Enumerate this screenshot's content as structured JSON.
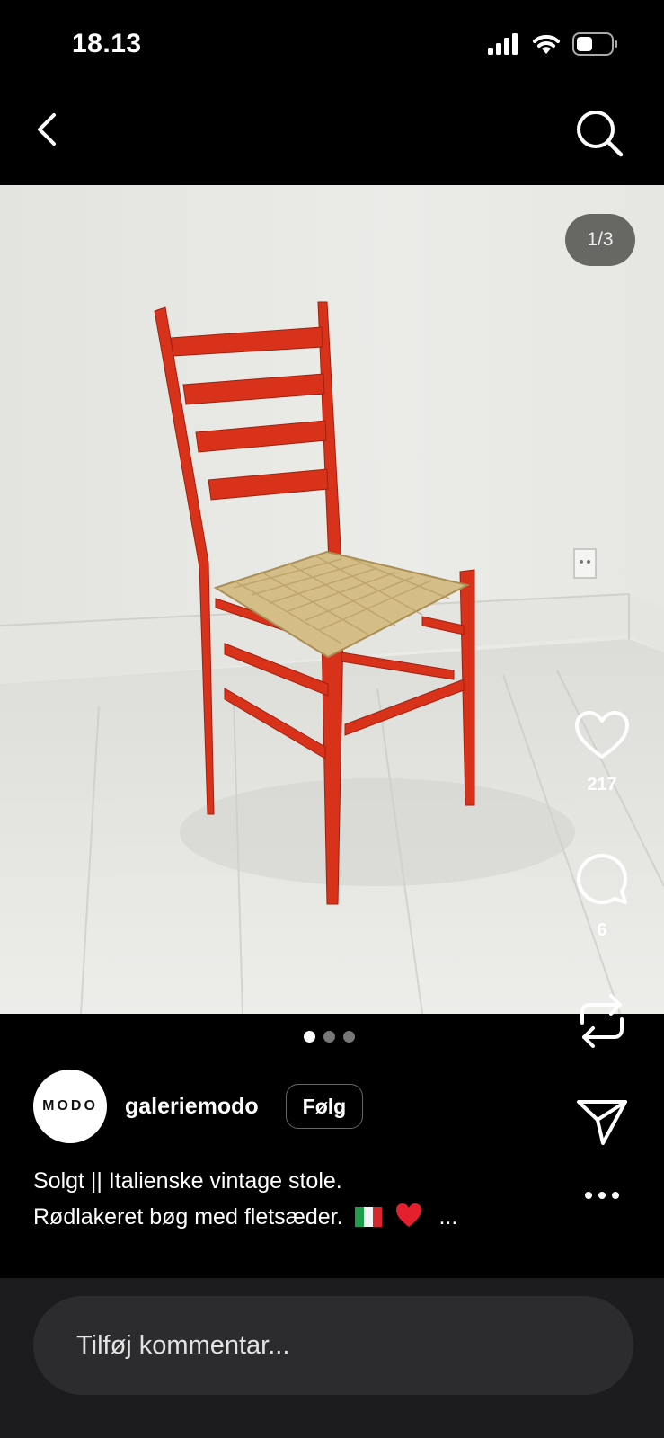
{
  "status_bar": {
    "time": "18.13",
    "icons": [
      "signal-icon",
      "wifi-icon",
      "battery-icon"
    ]
  },
  "nav": {
    "icons": [
      "back-chevron-icon",
      "search-icon"
    ]
  },
  "post": {
    "image_counter": "1/3",
    "pagination": {
      "current": 1,
      "total": 3
    },
    "likes": "217",
    "comments": "6",
    "author": {
      "avatar_text": "MODO",
      "username": "galeriemodo"
    },
    "follow_label": "Følg",
    "caption": {
      "line1": "Solgt || Italienske vintage stole.",
      "line2": "Rødlakeret bøg med fletsæder.",
      "emojis": [
        "italy-flag-icon",
        "red-heart-icon"
      ],
      "more": "..."
    }
  },
  "comment": {
    "placeholder": "Tilføj kommentar..."
  },
  "colors": {
    "background": "#000000",
    "comment_bar": "#1c1c1e",
    "comment_input": "#2c2c2f",
    "chair_red": "#d8321a"
  }
}
